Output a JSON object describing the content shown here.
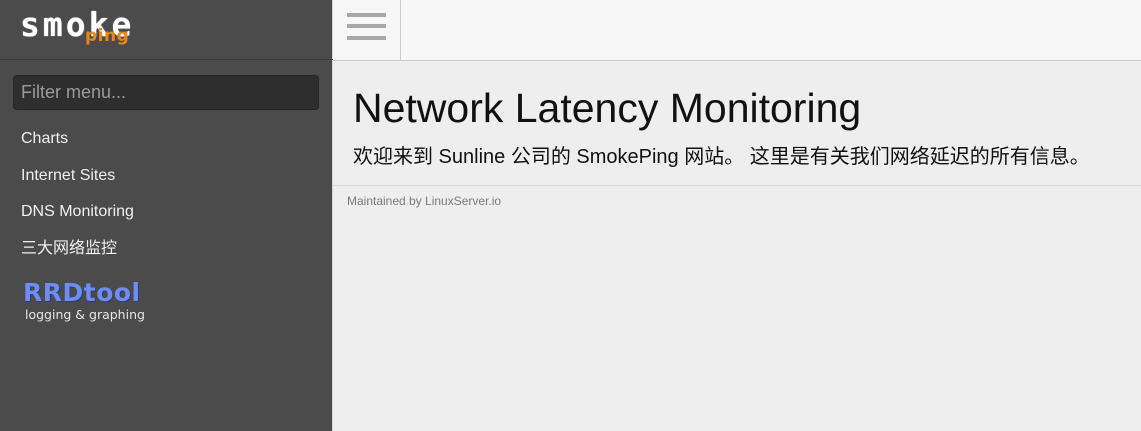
{
  "logo": {
    "main": "smoke",
    "accent": "ping"
  },
  "filter": {
    "placeholder": "Filter menu..."
  },
  "menu": [
    {
      "label": "Charts"
    },
    {
      "label": "Internet Sites"
    },
    {
      "label": "DNS Monitoring"
    },
    {
      "label": "三大网络监控"
    }
  ],
  "rrdtool": {
    "title": "RRDtool",
    "subtitle": "logging & graphing"
  },
  "toolbar": {
    "menu_icon": "hamburger-menu-icon"
  },
  "main": {
    "title": "Network Latency Monitoring",
    "welcome": "欢迎来到 Sunline 公司的 SmokePing 网站。 这里是有关我们网络延迟的所有信息。",
    "footer": "Maintained by LinuxServer.io"
  },
  "colors": {
    "sidebar_bg": "#4b4b4b",
    "content_bg": "#eeeeee",
    "logo_accent": "#e8861a",
    "rrdtool_blue": "#6f8cf2"
  }
}
